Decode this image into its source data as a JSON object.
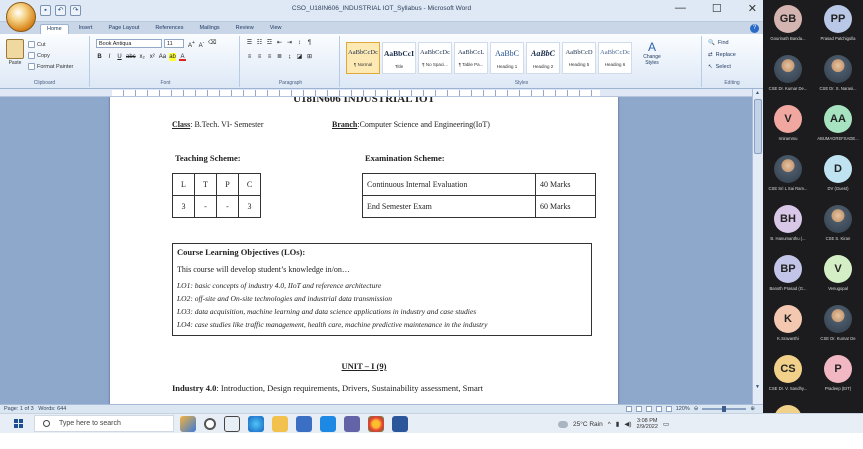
{
  "window": {
    "title": "CSO_U18IN606_INDUSTRIAL IOT_Syllabus - Microsoft Word",
    "controls": [
      "—",
      "☐",
      "✕"
    ]
  },
  "ribbon": {
    "tabs": [
      "Home",
      "Insert",
      "Page Layout",
      "References",
      "Mailings",
      "Review",
      "View"
    ],
    "clipboard": {
      "paste": "Paste",
      "cut": "Cut",
      "copy": "Copy",
      "format_painter": "Format Painter",
      "label": "Clipboard"
    },
    "font": {
      "name": "Book Antiqua",
      "size": "11",
      "label": "Font"
    },
    "paragraph_label": "Paragraph",
    "styles": [
      {
        "sample": "AaBbCcDc",
        "name": "¶ Normal"
      },
      {
        "sample": "AaBbCcI",
        "name": "Title"
      },
      {
        "sample": "AaBbCcDc",
        "name": "¶ No Spaci..."
      },
      {
        "sample": "AaBbCcL",
        "name": "¶ Table Pa..."
      },
      {
        "sample": "AaBbC",
        "name": "Heading 1"
      },
      {
        "sample": "AaBbC",
        "name": "Heading 2"
      },
      {
        "sample": "AaBbCcD",
        "name": "Heading 5"
      },
      {
        "sample": "AaBbCcDc",
        "name": "Heading 6"
      }
    ],
    "change_styles": "Change Styles",
    "styles_label": "Styles",
    "editing": {
      "find": "Find",
      "replace": "Replace",
      "select": "Select",
      "label": "Editing"
    }
  },
  "document": {
    "heading": "U18IN606 INDUSTRIAL IOT",
    "class_label": "Class",
    "class_value": ": B.Tech. VI- Semester",
    "branch_label": "Branch",
    "branch_value": ":Computer Science and Engineering(IoT)",
    "teaching_heading": "Teaching Scheme:",
    "examination_heading": "Examination Scheme:",
    "teaching_table": [
      [
        "L",
        "T",
        "P",
        "C"
      ],
      [
        "3",
        "-",
        "-",
        "3"
      ]
    ],
    "exam_table": [
      [
        "Continuous Internal Evaluation",
        "40 Marks"
      ],
      [
        "End Semester Exam",
        "60 Marks"
      ]
    ],
    "lo_title": "Course Learning Objectives (LOs):",
    "lo_intro": "This course will develop student’s knowledge in/on…",
    "lo_items": [
      "LO1: basic concepts of industry 4.0, IIoT and reference architecture",
      "LO2: off-site and On-site technologies and industrial data transmission",
      "LO3: data acquisition, machine learning and data science applications in industry and case studies",
      "LO4: case studies like traffic management, health care, machine predictive maintenance in the industry"
    ],
    "unit_heading": "UNIT – I (9)",
    "body_bold": "Industry 4.0",
    "body_text": ": Introduction, Design requirements, Drivers, Sustainability assessment, Smart"
  },
  "statusbar": {
    "page": "Page: 1 of 3",
    "words": "Words: 644",
    "zoom": "120%"
  },
  "taskbar": {
    "search_placeholder": "Type here to search",
    "weather": "25°C Rain",
    "time": "3:08 PM",
    "date": "2/9/2022"
  },
  "participants": [
    {
      "initials": "GB",
      "name": "Gourinath Banda...",
      "color": "#d4b4b0"
    },
    {
      "initials": "PP",
      "name": "Prasad Patchigolla",
      "color": "#b9c8e6"
    },
    {
      "initials": "",
      "name": "CSE Dr. Kumar De...",
      "color": "photo"
    },
    {
      "initials": "",
      "name": "CSE Dr. S. Narasi...",
      "color": "photo"
    },
    {
      "initials": "V",
      "name": "rmirammu",
      "color": "#f0a7a0"
    },
    {
      "initials": "AA",
      "name": "ABUMAGREFSADE...",
      "color": "#a7e3c1"
    },
    {
      "initials": "",
      "name": "CSE Sri L Sai Ram...",
      "color": "photo"
    },
    {
      "initials": "D",
      "name": "DV (Guest)",
      "color": "#bfe3f1"
    },
    {
      "initials": "BH",
      "name": "B. Hanumanthu (...",
      "color": "#d8c7e6"
    },
    {
      "initials": "",
      "name": "CSE S. Kiran",
      "color": "photo"
    },
    {
      "initials": "BP",
      "name": "Banoth Prasad (G...",
      "color": "#c2c4e8"
    },
    {
      "initials": "V",
      "name": "Venugopal",
      "color": "#d4efc5"
    },
    {
      "initials": "K",
      "name": "K.Sravanthi",
      "color": "#f3c7b0"
    },
    {
      "initials": "",
      "name": "CSE Dr. Kumar De",
      "color": "photo"
    },
    {
      "initials": "CS",
      "name": "CSE Dr. V. Sandhy...",
      "color": "#f1d08a"
    },
    {
      "initials": "P",
      "name": "Pradeep (EIT)",
      "color": "#f1b8c4"
    },
    {
      "initials": "CS",
      "name": "",
      "color": "#f1d08a"
    }
  ]
}
